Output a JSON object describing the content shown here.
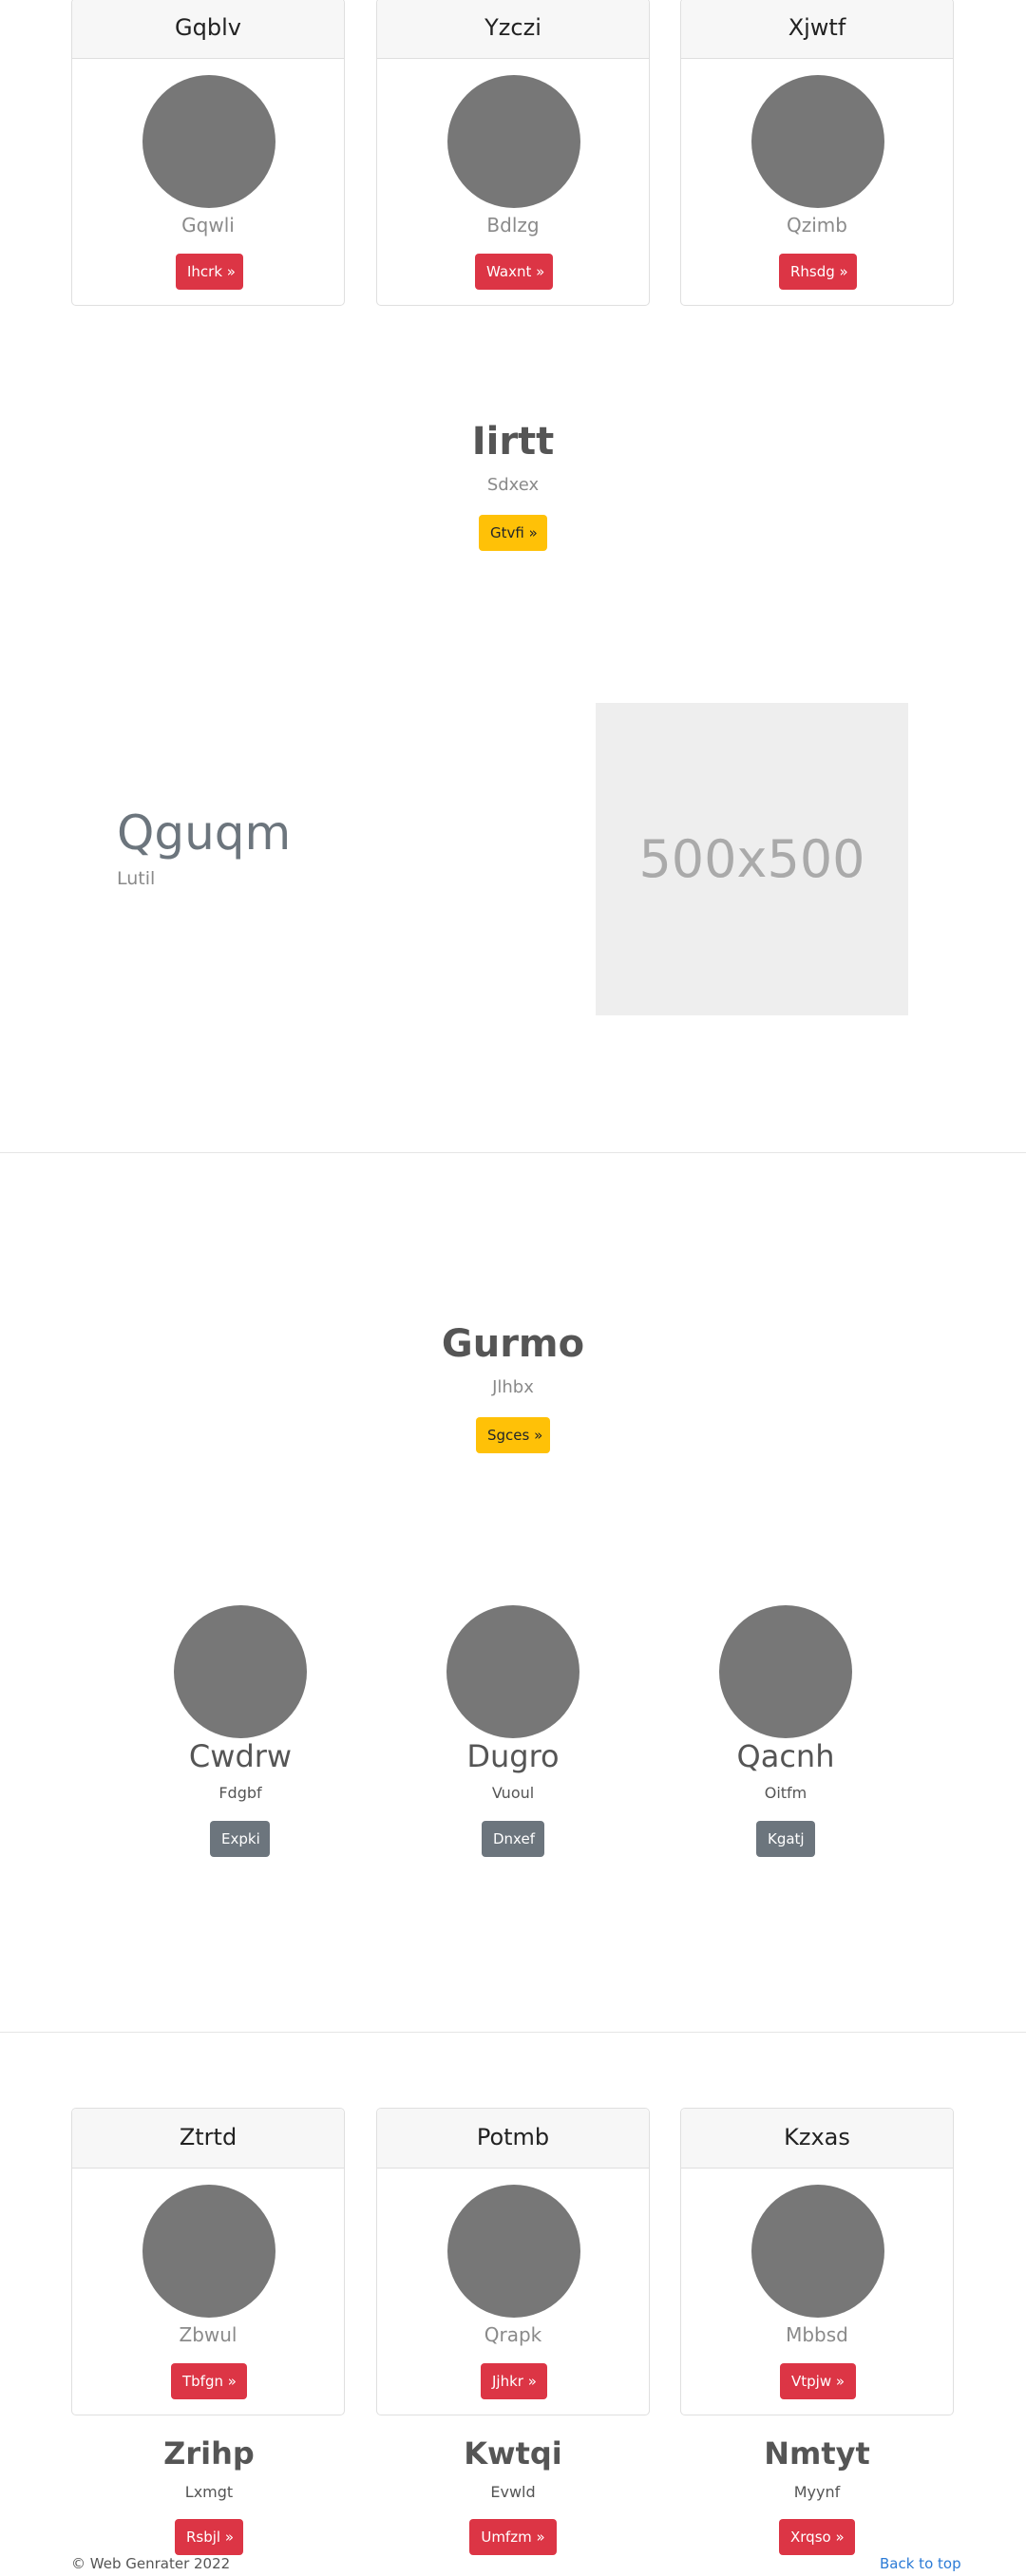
{
  "top_cards": [
    {
      "title": "Gqblv",
      "subtitle": "Gqwli",
      "button": "Ihcrk »"
    },
    {
      "title": "Yzczi",
      "subtitle": "Bdlzg",
      "button": "Waxnt »"
    },
    {
      "title": "Xjwtf",
      "subtitle": "Qzimb",
      "button": "Rhsdg »"
    }
  ],
  "section1": {
    "heading": "Iirtt",
    "subheading": "Sdxex",
    "button": "Gtvfi »"
  },
  "feature": {
    "title": "Qguqm",
    "subtitle": "Lutil",
    "placeholder_text": "500x500"
  },
  "section2": {
    "heading": "Gurmo",
    "subheading": "Jlhbx",
    "button": "Sgces »"
  },
  "people": [
    {
      "name": "Cwdrw",
      "sub": "Fdgbf",
      "button": "Expki"
    },
    {
      "name": "Dugro",
      "sub": "Vuoul",
      "button": "Dnxef"
    },
    {
      "name": "Qacnh",
      "sub": "Oitfm",
      "button": "Kgatj"
    }
  ],
  "bottom_cards": [
    {
      "title": "Ztrtd",
      "subtitle": "Zbwul",
      "button": "Tbfgn »"
    },
    {
      "title": "Potmb",
      "subtitle": "Qrapk",
      "button": "Jjhkr »"
    },
    {
      "title": "Kzxas",
      "subtitle": "Mbbsd",
      "button": "Vtpjw »"
    }
  ],
  "columns": [
    {
      "title": "Zrihp",
      "sub": "Lxmgt",
      "button": "Rsbjl »"
    },
    {
      "title": "Kwtqi",
      "sub": "Evwld",
      "button": "Umfzm »"
    },
    {
      "title": "Nmtyt",
      "sub": "Myynf",
      "button": "Xrqso »"
    }
  ],
  "footer": {
    "copyright": "© Web Genrater 2022",
    "back_to_top": "Back to top"
  }
}
